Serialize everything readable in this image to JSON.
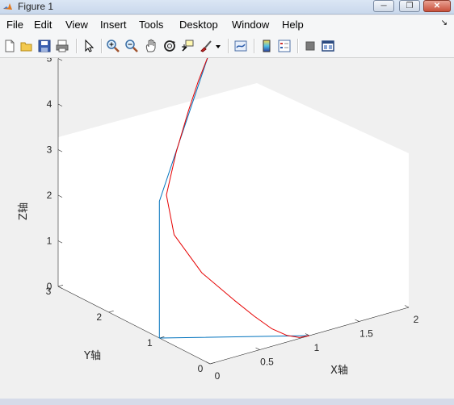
{
  "window": {
    "title": "Figure 1"
  },
  "menu": [
    "File",
    "Edit",
    "View",
    "Insert",
    "Tools",
    "Desktop",
    "Window",
    "Help"
  ],
  "toolbar": {
    "icons": [
      "new-figure-icon",
      "open-file-icon",
      "save-icon",
      "print-icon",
      "pointer-icon",
      "zoom-in-icon",
      "zoom-out-icon",
      "pan-icon",
      "rotate-3d-icon",
      "data-cursor-icon",
      "brush-icon",
      "brush-dropdown-icon",
      "link-plot-icon",
      "colorbar-icon",
      "legend-icon",
      "hide-plot-tools-icon",
      "show-plot-tools-icon"
    ]
  },
  "chart_data": {
    "type": "line3d",
    "xlabel": "X轴",
    "ylabel": "Y轴",
    "zlabel": "Z轴",
    "xlim": [
      0,
      2
    ],
    "ylim": [
      0,
      3
    ],
    "zlim": [
      0,
      5
    ],
    "xticks": [
      "0",
      "0.5",
      "1",
      "1.5",
      "2"
    ],
    "yticks": [
      "0",
      "1",
      "2",
      "3"
    ],
    "zticks": [
      "0",
      "1",
      "2",
      "3",
      "4",
      "5"
    ],
    "grid": false,
    "series": [
      {
        "color": "#0072bd",
        "x": [
          1.0,
          0.0,
          0.0,
          1.0
        ],
        "y": [
          0.0,
          1.0,
          1.0,
          2.0
        ],
        "z": [
          0.0,
          0.0,
          3.0,
          5.0
        ]
      },
      {
        "color": "#e60000",
        "x": [
          1.0,
          0.9,
          0.8,
          0.7,
          0.6,
          0.5,
          0.35,
          0.25,
          0.3,
          0.5,
          0.7,
          0.85,
          1.0
        ],
        "y": [
          0.0,
          0.0,
          0.05,
          0.15,
          0.3,
          0.5,
          0.85,
          1.2,
          1.45,
          1.65,
          1.8,
          1.9,
          2.0
        ],
        "z": [
          0.0,
          0.02,
          0.1,
          0.25,
          0.5,
          0.8,
          1.3,
          2.0,
          2.7,
          3.4,
          4.1,
          4.6,
          5.0
        ]
      }
    ]
  }
}
